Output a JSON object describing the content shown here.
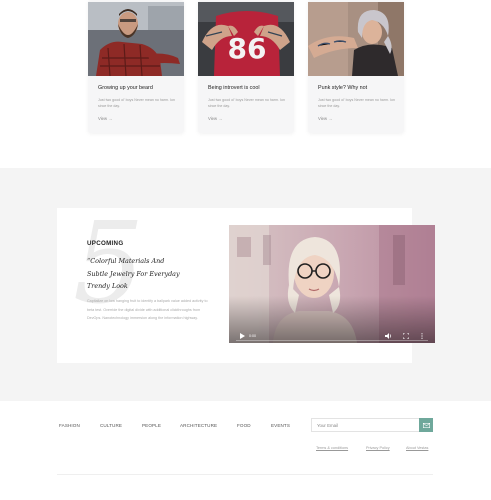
{
  "cards": [
    {
      "title": "Growing up your beard",
      "excerpt": "Just two good ol' boys Never mean no harm. Ion since the day.",
      "view_label": "View  →",
      "image": "bearded-man-in-plaid-shirt"
    },
    {
      "title": "Being introvert is cool",
      "excerpt": "Just two good ol' boys Never mean no harm. Ion since the day.",
      "view_label": "View  →",
      "image": "tattooed-hands-on-red-jersey"
    },
    {
      "title": "Punk style? Why not",
      "excerpt": "Just two good ol' boys Never mean no harm. Ion since the day.",
      "view_label": "View  →",
      "image": "woman-with-tattoos-and-grey-hair"
    }
  ],
  "upcoming": {
    "number": "5",
    "heading": "UPCOMING",
    "quote": "“Colorful Materials And Subtle Jewelry For Everyday Trendy Look",
    "description": "Capitalize on low hanging fruit to identify a ballpark value added activity to beta test. Override the digital divide with additional clickthroughs from DevOps. Nanotechnology immersion along the information highway.",
    "video": {
      "time": "0:00",
      "image": "blonde-woman-with-round-glasses",
      "icons": [
        "play-icon",
        "volume-icon",
        "fullscreen-icon",
        "more-options-icon"
      ]
    }
  },
  "footer": {
    "nav": [
      "FASHION",
      "CULTURE",
      "PEOPLE",
      "ARCHITECTURE",
      "FOOD",
      "EVENTS"
    ],
    "email_placeholder": "Your Email",
    "send_icon": "envelope-icon",
    "legal_links": [
      "Terms & conditions",
      "Privacy Policy",
      "About Vestas"
    ]
  },
  "colors": {
    "accent": "#6fa89b",
    "band_background": "#f4f4f4",
    "card_background": "#f6f6f7"
  }
}
